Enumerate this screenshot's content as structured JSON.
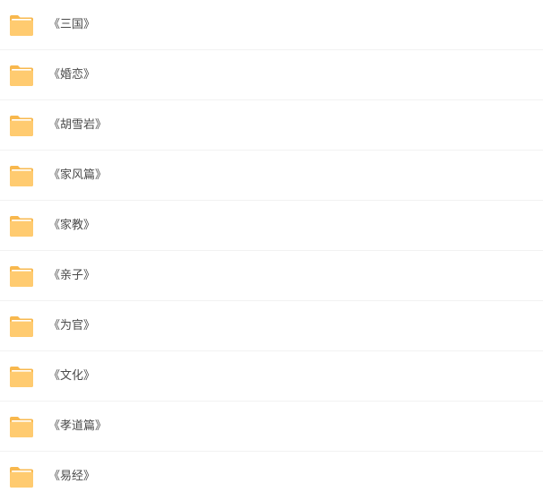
{
  "folders": [
    {
      "label": "《三国》"
    },
    {
      "label": "《婚恋》"
    },
    {
      "label": "《胡雪岩》"
    },
    {
      "label": "《家风篇》"
    },
    {
      "label": "《家教》"
    },
    {
      "label": "《亲子》"
    },
    {
      "label": "《为官》"
    },
    {
      "label": "《文化》"
    },
    {
      "label": "《孝道篇》"
    },
    {
      "label": "《易经》"
    }
  ],
  "colors": {
    "folder_back": "#f8b84e",
    "folder_front": "#ffcb70",
    "folder_tab_line": "#ffffff"
  },
  "icons": {
    "folder": "folder-icon"
  }
}
